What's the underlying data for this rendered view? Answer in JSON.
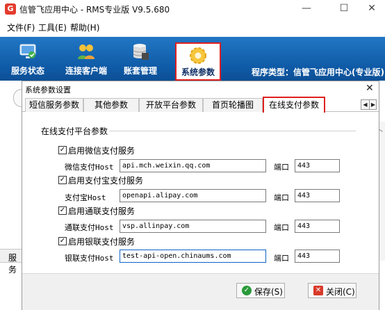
{
  "window": {
    "logo_glyph": "G",
    "title": "信管飞应用中心 - RMS专业版 V9.5.680",
    "minimize_glyph": "—",
    "maximize_glyph": "☐",
    "close_glyph": "✕"
  },
  "menu": [
    {
      "label": "文件(F)"
    },
    {
      "label": "工具(E)"
    },
    {
      "label": "帮助(H)"
    }
  ],
  "toolbar": {
    "items": [
      {
        "label": "服务状态",
        "icon": "monitor-icon"
      },
      {
        "label": "连接客户端",
        "icon": "users-icon"
      },
      {
        "label": "账套管理",
        "icon": "database-icon"
      },
      {
        "label": "系统参数",
        "icon": "gear-icon",
        "active": true
      }
    ],
    "program_type": "程序类型：信管飞应用中心(专业版)"
  },
  "background": {
    "left_strip_label": "服务"
  },
  "dialog": {
    "title": "系统参数设置",
    "close_glyph": "✕",
    "tabs": [
      {
        "label": "短信服务参数"
      },
      {
        "label": "其他参数"
      },
      {
        "label": "开放平台参数"
      },
      {
        "label": "首页轮播图"
      },
      {
        "label": "在线支付参数",
        "active": true
      }
    ],
    "group_title": "在线支付平台参数",
    "check_mark": "✓",
    "payments": [
      {
        "enable_label": "启用微信支付服务",
        "checked": true,
        "host_label": "微信支付Host",
        "host_value": "api.mch.weixin.qq.com",
        "port_label": "端口",
        "port_value": "443"
      },
      {
        "enable_label": "启用支付宝支付服务",
        "checked": true,
        "host_label": "支付宝Host",
        "host_value": "openapi.alipay.com",
        "port_label": "端口",
        "port_value": "443"
      },
      {
        "enable_label": "启用通联支付服务",
        "checked": true,
        "host_label": "通联支付Host",
        "host_value": "vsp.allinpay.com",
        "port_label": "端口",
        "port_value": "443"
      },
      {
        "enable_label": "启用银联支付服务",
        "checked": true,
        "host_label": "银联支付Host",
        "host_value": "test-api-open.chinaums.com",
        "port_label": "端口",
        "port_value": "443"
      }
    ],
    "save_button": {
      "label": "保存(S)",
      "icon": "check-icon",
      "glyph": "✓"
    },
    "close_button": {
      "label": "关闭(C)",
      "icon": "close-icon",
      "glyph": "✕"
    }
  },
  "colors": {
    "toolbar_blue": "#0f5aa6",
    "highlight_red": "#e02020",
    "save_green": "#2a9a3a",
    "close_red": "#d83a2a"
  }
}
